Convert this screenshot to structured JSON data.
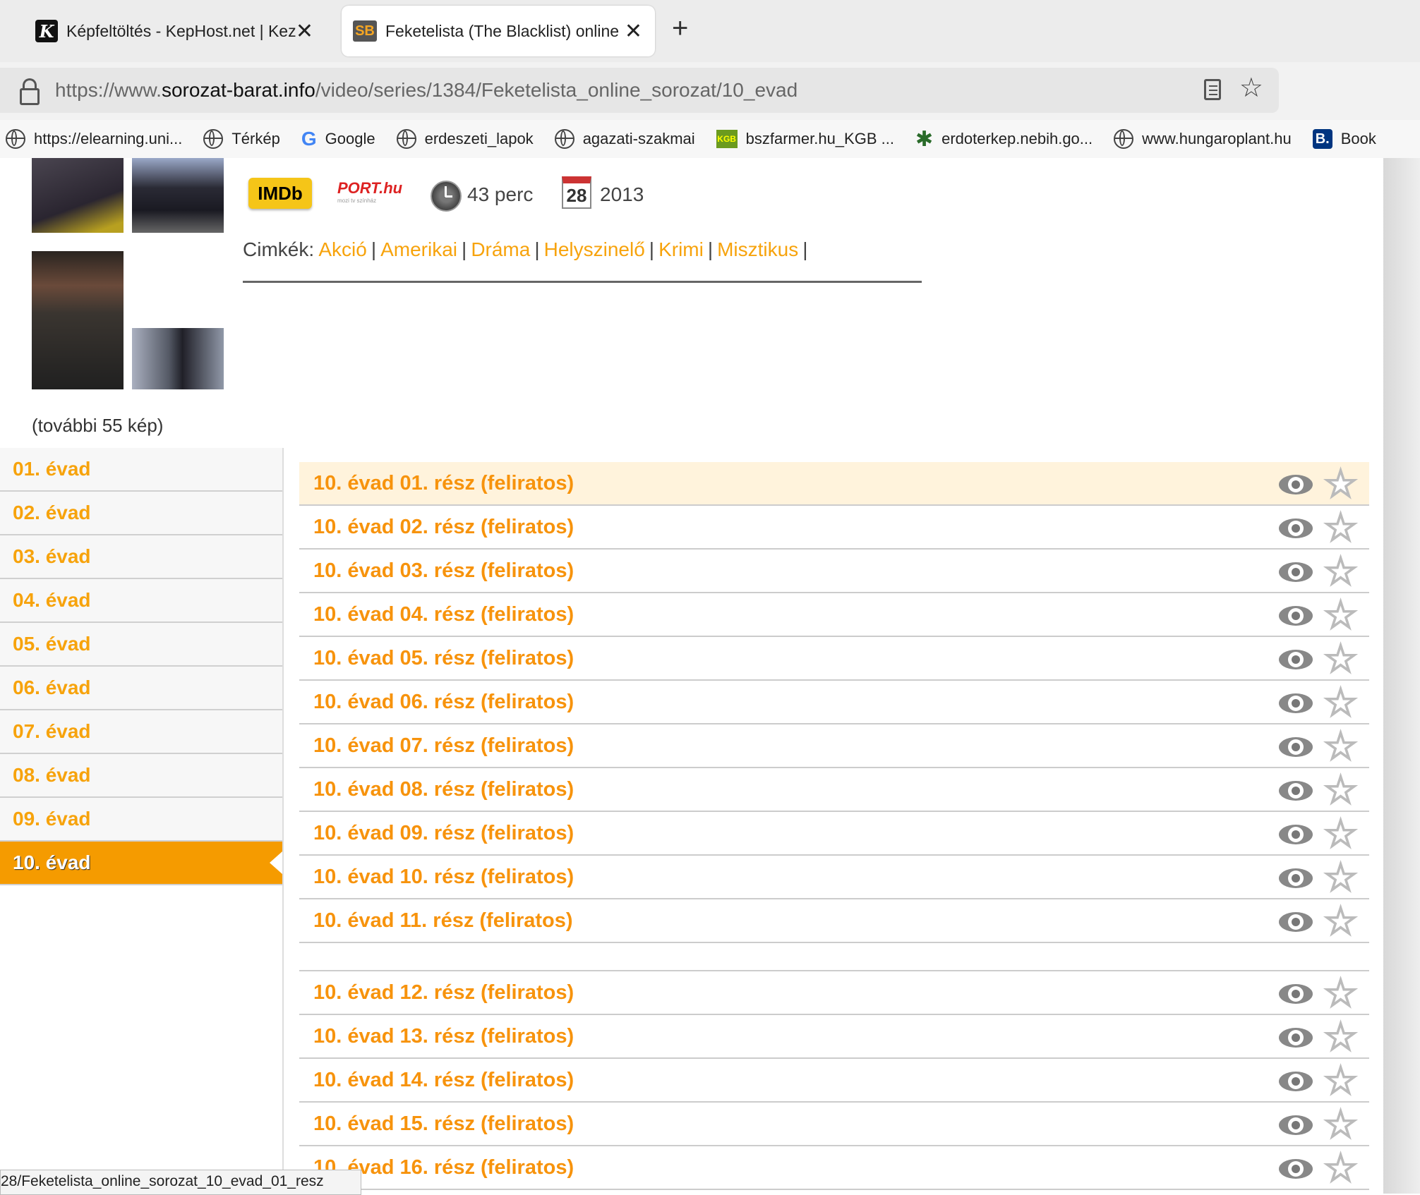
{
  "tabs": [
    {
      "title": "Képfeltöltés - KepHost.net | Kez",
      "icon": "kephost-icon",
      "active": false
    },
    {
      "title": "Feketelista (The Blacklist) online",
      "icon": "sb-icon",
      "active": true
    }
  ],
  "address": {
    "prefix": "https://www.",
    "domain": "sorozat-barat.info",
    "path": "/video/series/1384/Feketelista_online_sorozat/10_evad"
  },
  "bookmarks": [
    {
      "label": "https://elearning.uni...",
      "icon": "globe-icon"
    },
    {
      "label": "Térkép",
      "icon": "globe-icon"
    },
    {
      "label": "Google",
      "icon": "google-icon"
    },
    {
      "label": "erdeszeti_lapok",
      "icon": "globe-icon"
    },
    {
      "label": "agazati-szakmai",
      "icon": "globe-icon"
    },
    {
      "label": "bszfarmer.hu_KGB ...",
      "icon": "kgb-icon"
    },
    {
      "label": "erdoterkep.nebih.go...",
      "icon": "leaf-icon"
    },
    {
      "label": "www.hungaroplant.hu",
      "icon": "globe-icon"
    },
    {
      "label": "Book",
      "icon": "booking-icon"
    }
  ],
  "info": {
    "imdb": "IMDb",
    "port": "PORT.hu",
    "port_sub": "mozi tv színház",
    "duration": "43 perc",
    "calendar_day": "28",
    "year": "2013",
    "tags_label": "Cimkék:",
    "tags": [
      "Akció",
      "Amerikai",
      "Dráma",
      "Helyszinelő",
      "Krimi",
      "Misztikus"
    ],
    "more_pictures": "(további 55 kép)"
  },
  "seasons": [
    "01. évad",
    "02. évad",
    "03. évad",
    "04. évad",
    "05. évad",
    "06. évad",
    "07. évad",
    "08. évad",
    "09. évad",
    "10. évad"
  ],
  "active_season_index": 9,
  "episodes_group1": [
    "10. évad 01. rész (feliratos)",
    "10. évad 02. rész (feliratos)",
    "10. évad 03. rész (feliratos)",
    "10. évad 04. rész (feliratos)",
    "10. évad 05. rész (feliratos)",
    "10. évad 06. rész (feliratos)",
    "10. évad 07. rész (feliratos)",
    "10. évad 08. rész (feliratos)",
    "10. évad 09. rész (feliratos)",
    "10. évad 10. rész (feliratos)",
    "10. évad 11. rész (feliratos)"
  ],
  "episodes_group2": [
    "10. évad 12. rész (feliratos)",
    "10. évad 13. rész (feliratos)",
    "10. évad 14. rész (feliratos)",
    "10. évad 15. rész (feliratos)",
    "10. évad 16. rész (feliratos)"
  ],
  "status_url": "28/Feketelista_online_sorozat_10_evad_01_resz",
  "colors": {
    "accent": "#f7a30c",
    "active_season": "#f59b00",
    "highlight_row": "#fff3dc"
  }
}
